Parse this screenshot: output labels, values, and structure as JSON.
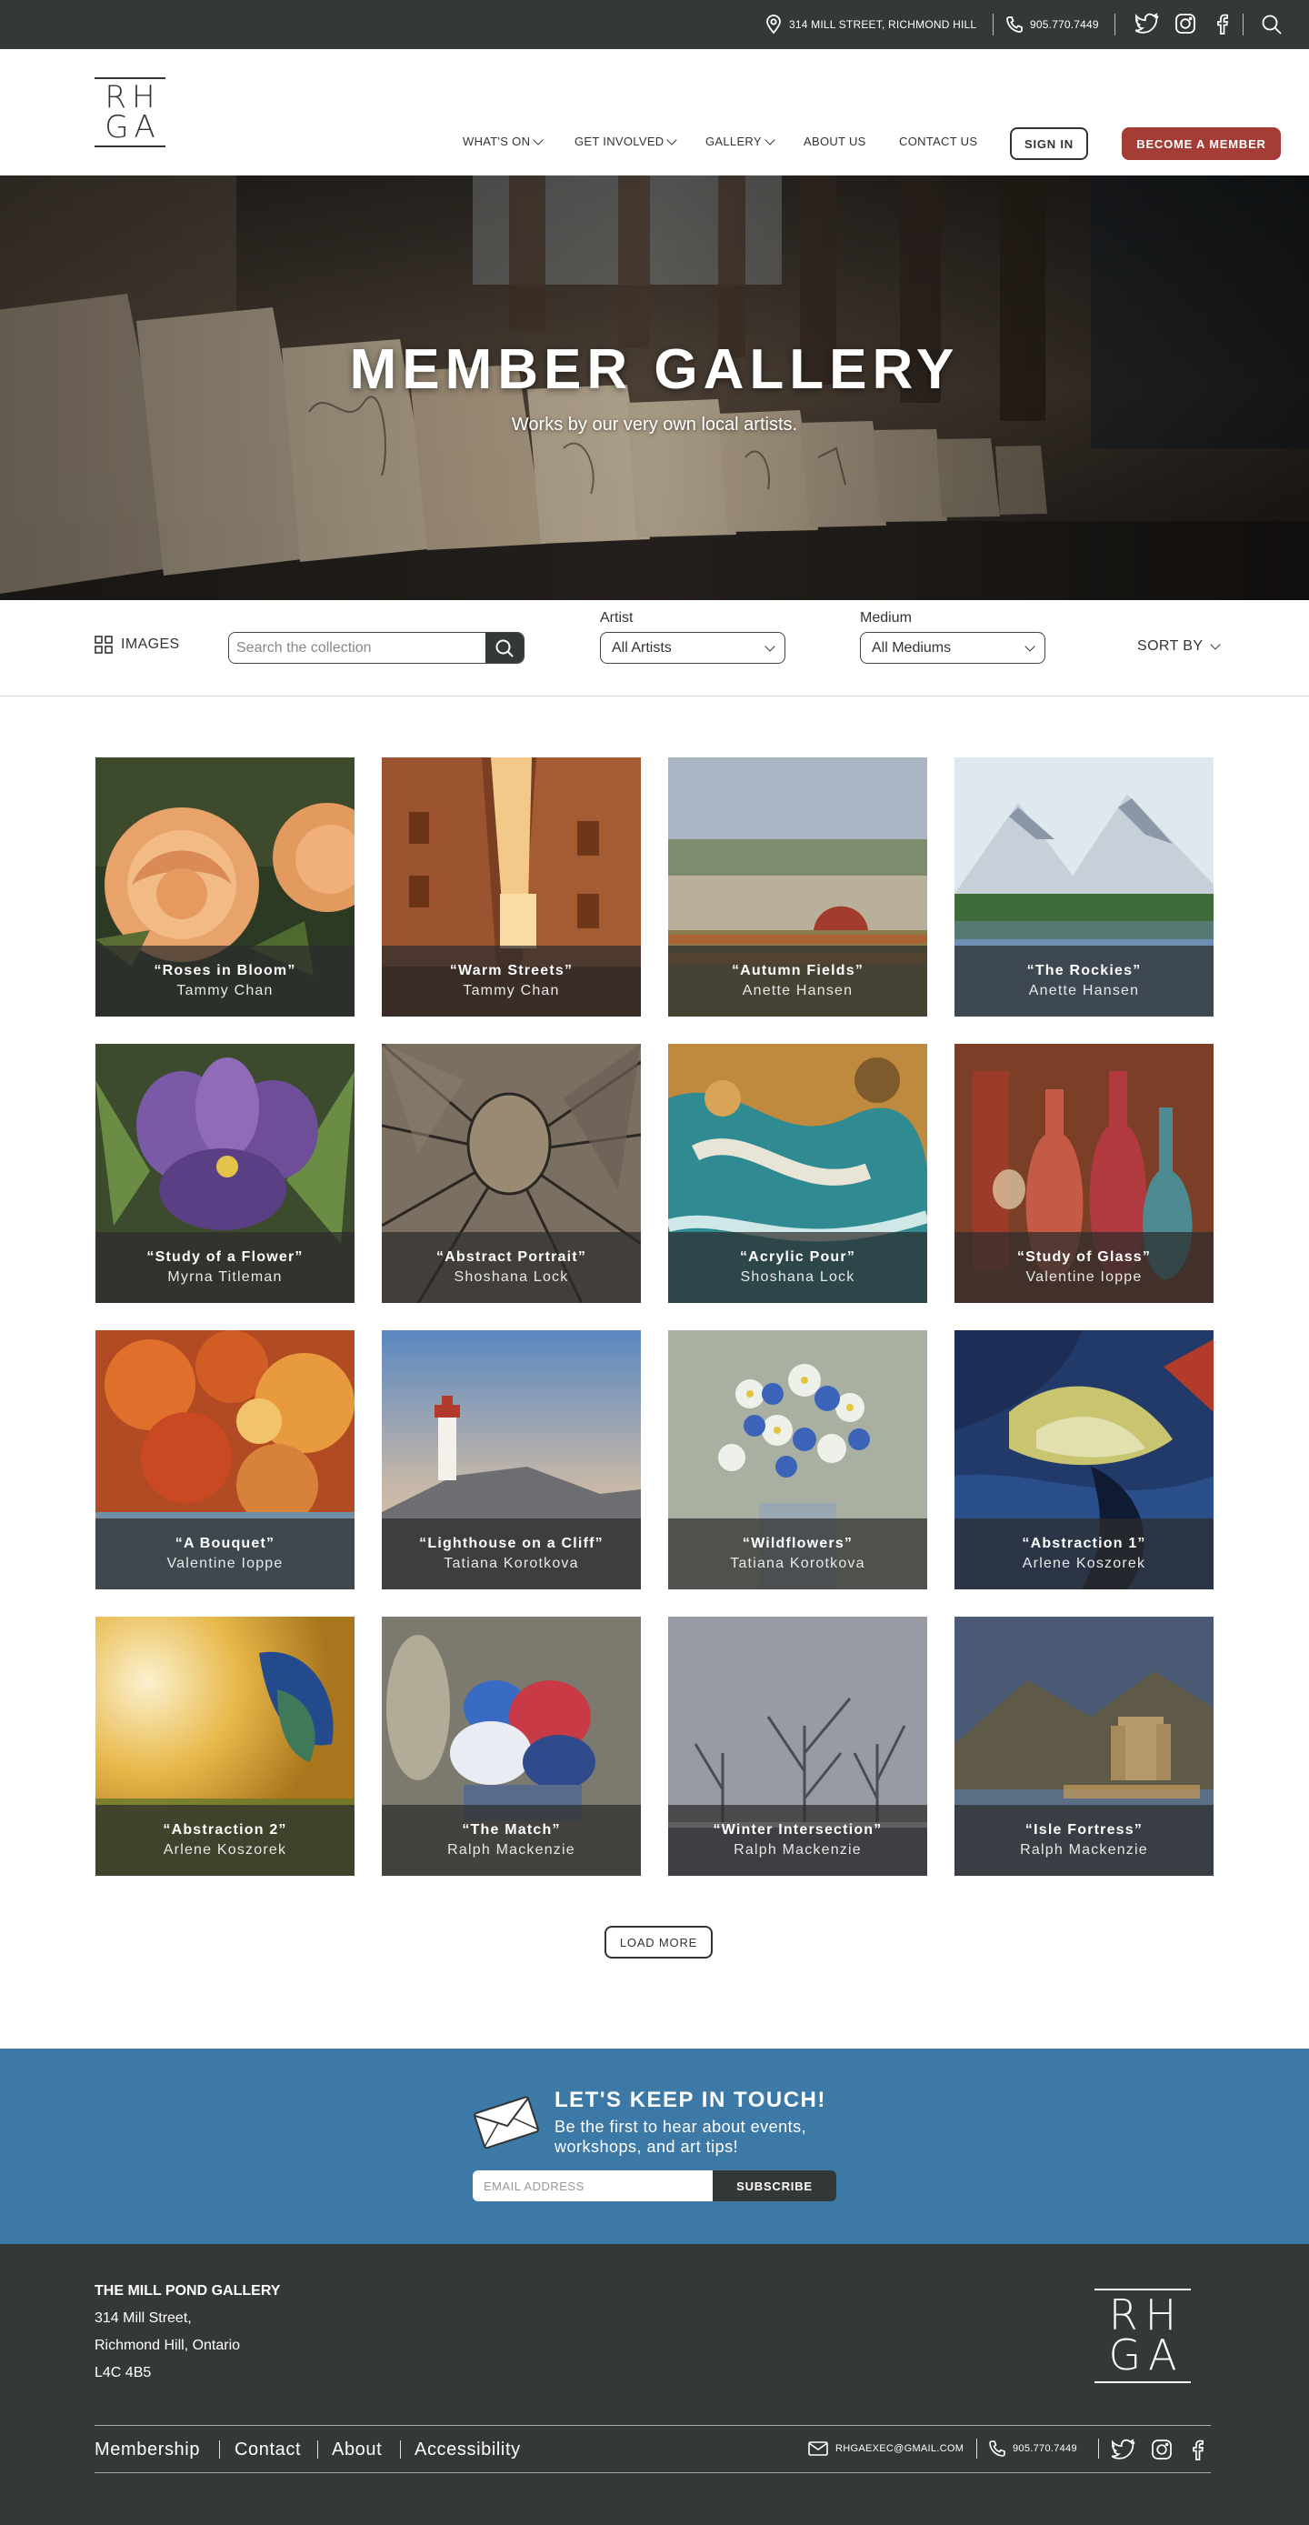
{
  "topbar": {
    "address": "314 MILL STREET, RICHMOND HILL",
    "phone": "905.770.7449",
    "icons": [
      "location-pin-icon",
      "phone-icon",
      "twitter-icon",
      "instagram-icon",
      "facebook-icon",
      "search-icon"
    ]
  },
  "header": {
    "logo": {
      "line1": "RH",
      "line2": "GA"
    },
    "nav": [
      {
        "label": "WHAT'S ON"
      },
      {
        "label": "GET INVOLVED"
      },
      {
        "label": "GALLERY"
      },
      {
        "label": "ABOUT US"
      },
      {
        "label": "CONTACT US"
      }
    ],
    "signin_label": "SIGN IN",
    "member_label": "BECOME A MEMBER"
  },
  "hero": {
    "title": "MEMBER GALLERY",
    "subtitle": "Works by our very own local artists."
  },
  "filters": {
    "view_label": "IMAGES",
    "search_placeholder": "Search the collection",
    "artist_label": "Artist",
    "artist_value": "All Artists",
    "medium_label": "Medium",
    "medium_value": "All Mediums",
    "sort_label": "SORT BY"
  },
  "gallery": [
    {
      "title": "“Roses in Bloom”",
      "artist": "Tammy Chan"
    },
    {
      "title": "“Warm Streets”",
      "artist": "Tammy Chan"
    },
    {
      "title": "“Autumn Fields”",
      "artist": "Anette Hansen"
    },
    {
      "title": "“The Rockies”",
      "artist": "Anette Hansen"
    },
    {
      "title": "“Study of a Flower”",
      "artist": "Myrna Titleman"
    },
    {
      "title": "“Abstract Portrait”",
      "artist": "Shoshana Lock"
    },
    {
      "title": "“Acrylic Pour”",
      "artist": "Shoshana Lock"
    },
    {
      "title": "“Study of Glass”",
      "artist": "Valentine Ioppe"
    },
    {
      "title": "“A Bouquet”",
      "artist": "Valentine Ioppe"
    },
    {
      "title": "“Lighthouse on a Cliff”",
      "artist": "Tatiana Korotkova"
    },
    {
      "title": "“Wildflowers”",
      "artist": "Tatiana Korotkova"
    },
    {
      "title": "“Abstraction 1”",
      "artist": "Arlene Koszorek"
    },
    {
      "title": "“Abstraction 2”",
      "artist": "Arlene Koszorek"
    },
    {
      "title": "“The Match”",
      "artist": "Ralph Mackenzie"
    },
    {
      "title": "“Winter Intersection”",
      "artist": "Ralph Mackenzie"
    },
    {
      "title": "“Isle Fortress”",
      "artist": "Ralph Mackenzie"
    }
  ],
  "load_more_label": "LOAD MORE",
  "newsletter": {
    "title": "LET'S KEEP IN TOUCH!",
    "text": "Be the first to hear about events, workshops, and art tips!",
    "email_placeholder": "EMAIL ADDRESS",
    "subscribe_label": "SUBSCRIBE"
  },
  "footer": {
    "name": "THE MILL POND GALLERY",
    "address1": "314 Mill Street,",
    "address2": "Richmond Hill, Ontario",
    "postal": "L4C 4B5",
    "links": [
      "Membership",
      "Contact",
      "About",
      "Accessibility"
    ],
    "email": "RHGAEXEC@GMAIL.COM",
    "phone": "905.770.7449"
  },
  "colors": {
    "dark": "#353839",
    "accent": "#a33d35",
    "newsletter_bg": "#3c79a7"
  }
}
